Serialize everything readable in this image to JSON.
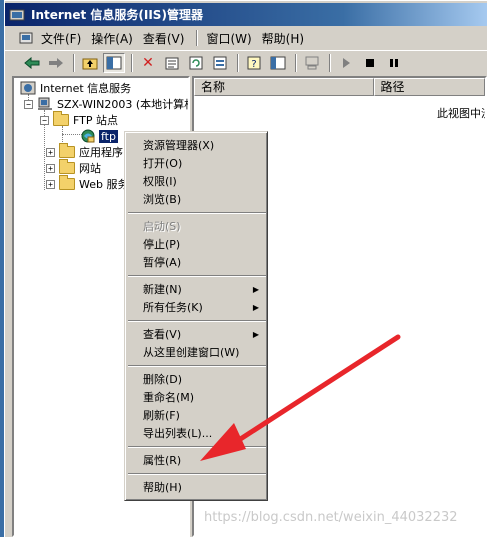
{
  "window": {
    "title": "Internet 信息服务(IIS)管理器"
  },
  "menubar": {
    "items": [
      "文件(F)",
      "操作(A)",
      "查看(V)",
      "窗口(W)",
      "帮助(H)"
    ]
  },
  "toolbar": {
    "buttons": [
      "back-icon",
      "forward-icon",
      "up-icon",
      "show-tree-icon",
      "delete-icon",
      "properties-icon",
      "refresh-icon",
      "export-icon",
      "help-icon",
      "console-icon",
      "computer-icon",
      "start-icon",
      "stop-icon",
      "pause-icon"
    ]
  },
  "tree": {
    "root": "Internet 信息服务",
    "server": "SZX-WIN2003 (本地计算机",
    "ftp_sites": "FTP 站点",
    "ftp": "ftp",
    "app_pools": "应用程序",
    "websites": "网站",
    "web_ext": "Web 服务"
  },
  "list": {
    "columns": [
      "名称",
      "路径"
    ],
    "empty_text": "此视图中没"
  },
  "context_menu": {
    "items": [
      {
        "label": "资源管理器(X)",
        "disabled": false
      },
      {
        "label": "打开(O)",
        "disabled": false
      },
      {
        "label": "权限(I)",
        "disabled": false
      },
      {
        "label": "浏览(B)",
        "disabled": false
      },
      {
        "label": "启动(S)",
        "disabled": true
      },
      {
        "label": "停止(P)",
        "disabled": false
      },
      {
        "label": "暂停(A)",
        "disabled": false
      },
      {
        "label": "新建(N)",
        "disabled": false,
        "submenu": true
      },
      {
        "label": "所有任务(K)",
        "disabled": false,
        "submenu": true
      },
      {
        "label": "查看(V)",
        "disabled": false,
        "submenu": true
      },
      {
        "label": "从这里创建窗口(W)",
        "disabled": false
      },
      {
        "label": "删除(D)",
        "disabled": false
      },
      {
        "label": "重命名(M)",
        "disabled": false
      },
      {
        "label": "刷新(F)",
        "disabled": false
      },
      {
        "label": "导出列表(L)...",
        "disabled": false
      },
      {
        "label": "属性(R)",
        "disabled": false
      },
      {
        "label": "帮助(H)",
        "disabled": false
      }
    ]
  },
  "annotation": {
    "arrow_color": "#e8262b"
  },
  "watermark": "https://blog.csdn.net/weixin_44032232"
}
